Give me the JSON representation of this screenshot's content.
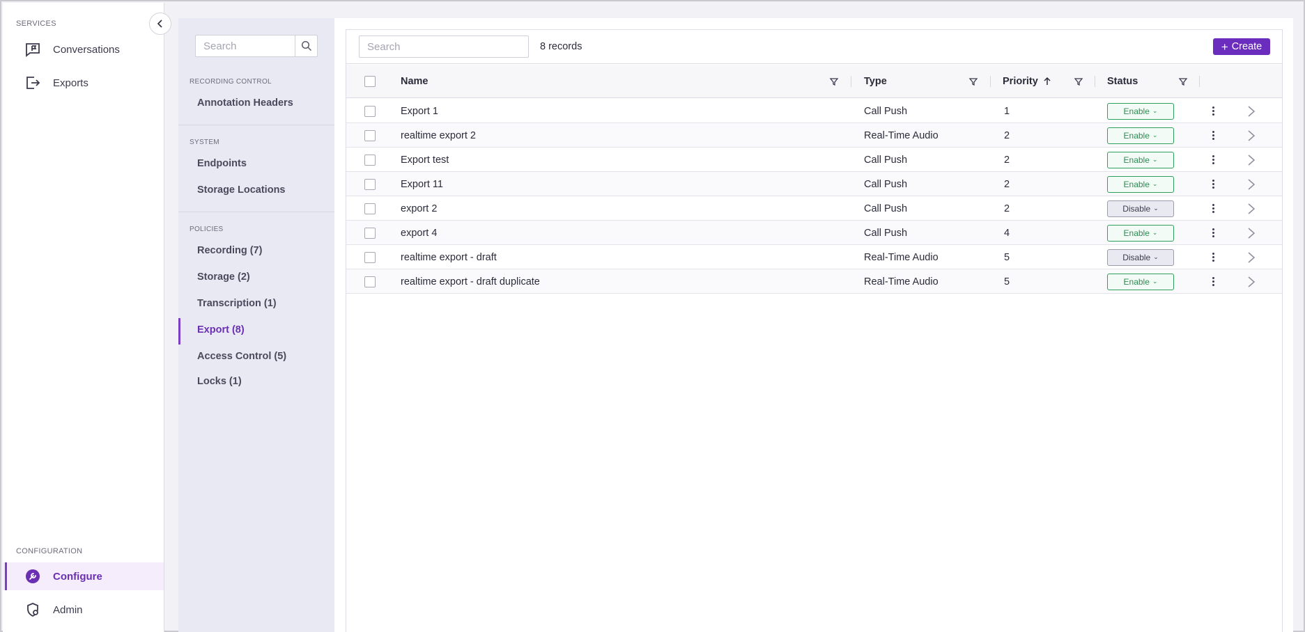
{
  "leftnav": {
    "services_label": "SERVICES",
    "config_label": "CONFIGURATION",
    "items": [
      {
        "label": "Conversations",
        "icon": "chat-flag-icon"
      },
      {
        "label": "Exports",
        "icon": "export-icon"
      }
    ],
    "bottom_items": [
      {
        "label": "Configure",
        "icon": "wrench-icon",
        "active": true
      },
      {
        "label": "Admin",
        "icon": "shield-gear-icon"
      }
    ]
  },
  "subnav": {
    "search_placeholder": "Search",
    "sections": [
      {
        "label": "RECORDING CONTROL",
        "items": [
          "Annotation Headers"
        ]
      },
      {
        "label": "SYSTEM",
        "items": [
          "Endpoints",
          "Storage Locations"
        ]
      },
      {
        "label": "POLICIES",
        "items": [
          "Recording (7)",
          "Storage (2)",
          "Transcription (1)",
          "Export (8)",
          "Access Control (5)",
          "Locks (1)"
        ]
      }
    ],
    "active_item": "Export (8)"
  },
  "toolbar": {
    "search_placeholder": "Search",
    "records": "8 records",
    "create_label": "Create"
  },
  "table": {
    "columns": {
      "name": "Name",
      "type": "Type",
      "priority": "Priority",
      "status": "Status"
    },
    "sort": {
      "column": "Priority",
      "direction": "ascending"
    },
    "rows": [
      {
        "name": "Export 1",
        "type": "Call Push",
        "priority": "1",
        "status": "Enable"
      },
      {
        "name": "realtime export 2",
        "type": "Real-Time Audio",
        "priority": "2",
        "status": "Enable"
      },
      {
        "name": "Export test",
        "type": "Call Push",
        "priority": "2",
        "status": "Enable"
      },
      {
        "name": "Export 11",
        "type": "Call Push",
        "priority": "2",
        "status": "Enable"
      },
      {
        "name": "export 2",
        "type": "Call Push",
        "priority": "2",
        "status": "Disable"
      },
      {
        "name": "export 4",
        "type": "Call Push",
        "priority": "4",
        "status": "Enable"
      },
      {
        "name": "realtime export - draft",
        "type": "Real-Time Audio",
        "priority": "5",
        "status": "Disable"
      },
      {
        "name": "realtime export - draft duplicate",
        "type": "Real-Time Audio",
        "priority": "5",
        "status": "Enable"
      }
    ]
  },
  "colors": {
    "accent": "#6b2dbd",
    "enable": "#2f9e5a",
    "disable_bg": "#e9e9f2"
  }
}
